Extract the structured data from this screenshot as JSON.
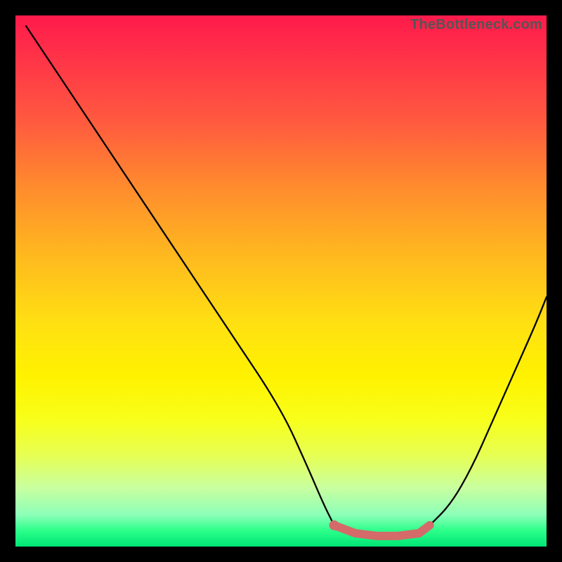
{
  "watermark": "TheBottleneck.com",
  "colors": {
    "accent": "#d46a6a",
    "curve": "#000000",
    "gradient_top": "#ff1a4b",
    "gradient_bottom": "#00e676",
    "frame": "#000000"
  },
  "chart_data": {
    "type": "line",
    "title": "",
    "xlabel": "",
    "ylabel": "",
    "xlim": [
      0,
      100
    ],
    "ylim": [
      0,
      100
    ],
    "grid": false,
    "legend": false,
    "series": [
      {
        "name": "left-curve",
        "x": [
          2,
          10,
          20,
          30,
          40,
          50,
          55,
          58,
          60
        ],
        "y": [
          98,
          86,
          71,
          56,
          41,
          26,
          15,
          8,
          4
        ]
      },
      {
        "name": "right-curve",
        "x": [
          78,
          82,
          86,
          90,
          94,
          98,
          100
        ],
        "y": [
          4,
          8,
          15,
          24,
          33,
          42,
          47
        ]
      },
      {
        "name": "accent-flat",
        "x": [
          60,
          64,
          68,
          72,
          76,
          78
        ],
        "y": [
          4,
          2.5,
          2,
          2,
          2.5,
          4
        ]
      }
    ],
    "annotations": [
      {
        "type": "dot",
        "x": 60,
        "y": 4,
        "series": "accent-flat"
      }
    ]
  }
}
